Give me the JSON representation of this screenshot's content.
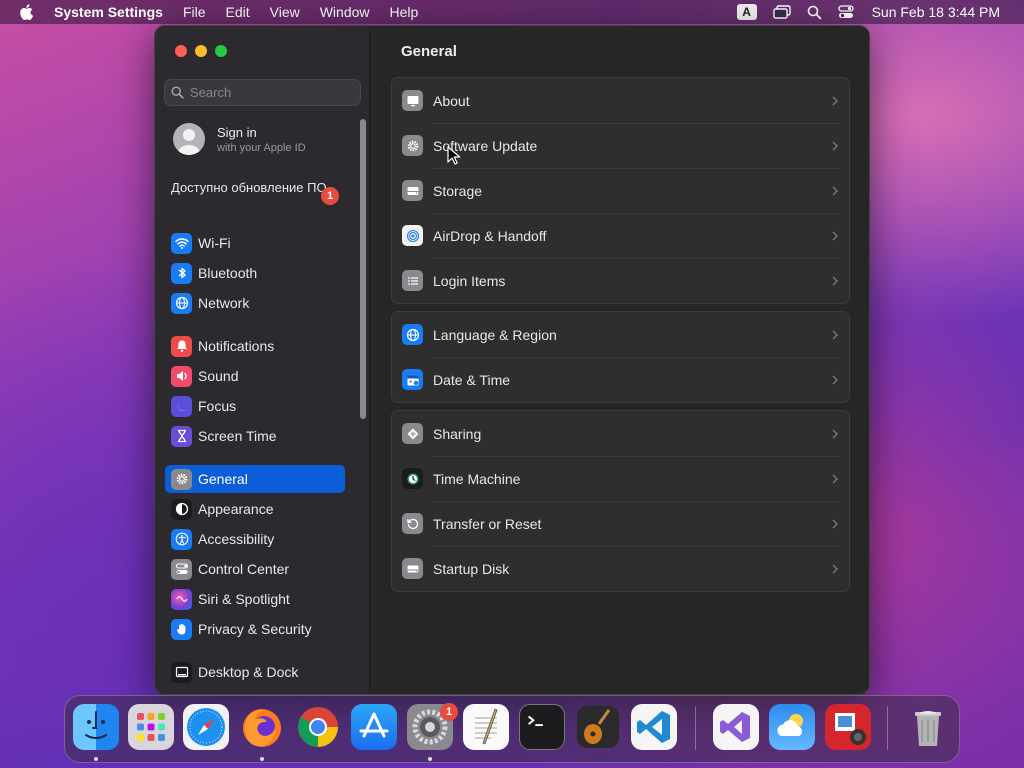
{
  "menubar": {
    "app_name": "System Settings",
    "items": [
      "File",
      "Edit",
      "View",
      "Window",
      "Help"
    ],
    "input_indicator": "A",
    "clock": "Sun Feb 18  3:44 PM"
  },
  "sidebar": {
    "search_placeholder": "Search",
    "account": {
      "title": "Sign in",
      "subtitle": "with your Apple ID"
    },
    "update_notice": "Доступно обновление ПО",
    "update_badge": "1",
    "items": [
      {
        "label": "Wi-Fi",
        "icon": "wifi-icon",
        "color": "#1a7cf5"
      },
      {
        "label": "Bluetooth",
        "icon": "bluetooth-icon",
        "color": "#1a7cf5"
      },
      {
        "label": "Network",
        "icon": "globe-icon",
        "color": "#1a7cf5"
      },
      {
        "label": "Notifications",
        "icon": "bell-icon",
        "color": "#ef4b4b"
      },
      {
        "label": "Sound",
        "icon": "speaker-icon",
        "color": "#ef4b6a"
      },
      {
        "label": "Focus",
        "icon": "moon-icon",
        "color": "#5b4ed8"
      },
      {
        "label": "Screen Time",
        "icon": "hourglass-icon",
        "color": "#6a4ed8"
      },
      {
        "label": "General",
        "icon": "gear-icon",
        "color": "#8a8a8e"
      },
      {
        "label": "Appearance",
        "icon": "appearance-icon",
        "color": "#1c1c1e"
      },
      {
        "label": "Accessibility",
        "icon": "accessibility-icon",
        "color": "#1a7cf5"
      },
      {
        "label": "Control Center",
        "icon": "toggles-icon",
        "color": "#8a8a8e"
      },
      {
        "label": "Siri & Spotlight",
        "icon": "siri-icon",
        "color": "#7a3fd0"
      },
      {
        "label": "Privacy & Security",
        "icon": "hand-icon",
        "color": "#1a7cf5"
      },
      {
        "label": "Desktop & Dock",
        "icon": "dock-icon",
        "color": "#1c1c1e"
      }
    ],
    "selected": "General"
  },
  "main": {
    "title": "General",
    "groups": [
      [
        {
          "label": "About",
          "icon": "monitor-icon"
        },
        {
          "label": "Software Update",
          "icon": "gear-update-icon"
        },
        {
          "label": "Storage",
          "icon": "drive-icon"
        },
        {
          "label": "AirDrop & Handoff",
          "icon": "airdrop-icon"
        },
        {
          "label": "Login Items",
          "icon": "list-icon"
        }
      ],
      [
        {
          "label": "Language & Region",
          "icon": "globe-icon"
        },
        {
          "label": "Date & Time",
          "icon": "calendar-icon"
        }
      ],
      [
        {
          "label": "Sharing",
          "icon": "sharing-icon"
        },
        {
          "label": "Time Machine",
          "icon": "time-machine-icon"
        },
        {
          "label": "Transfer or Reset",
          "icon": "reset-icon"
        },
        {
          "label": "Startup Disk",
          "icon": "disk-icon"
        }
      ]
    ]
  },
  "dock": {
    "apps": [
      "finder-icon",
      "launchpad-icon",
      "safari-icon",
      "firefox-icon",
      "chrome-icon",
      "app-store-icon",
      "system-settings-icon",
      "textedit-icon",
      "terminal-icon",
      "garageband-icon",
      "vscode-icon",
      "visual-studio-icon",
      "weather-icon",
      "photo-booth-icon",
      "trash-icon"
    ],
    "settings_badge": "1"
  }
}
